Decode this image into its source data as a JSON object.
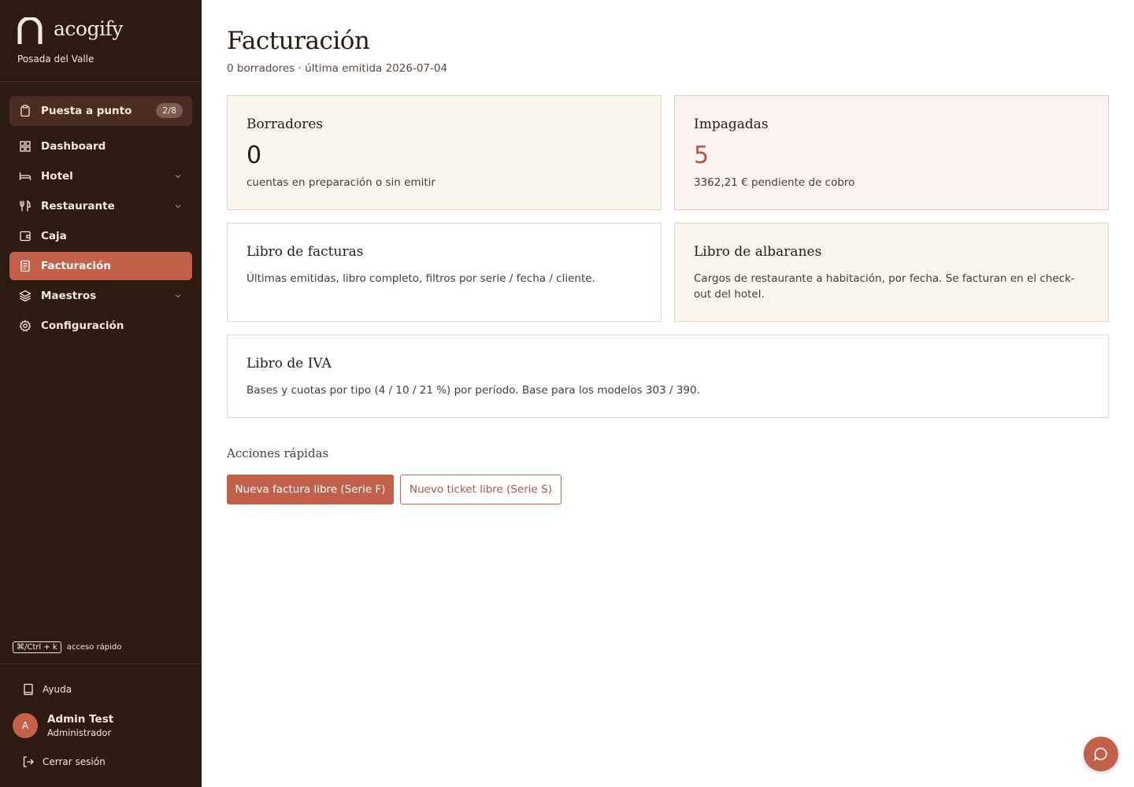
{
  "brand": {
    "name": "acogify",
    "property": "Posada del Valle"
  },
  "nav": {
    "setup": {
      "label": "Puesta a punto",
      "badge": "2/8"
    },
    "items": [
      {
        "label": "Dashboard",
        "icon": "grid-icon"
      },
      {
        "label": "Hotel",
        "icon": "bed-icon",
        "expandable": true
      },
      {
        "label": "Restaurante",
        "icon": "utensils-icon",
        "expandable": true
      },
      {
        "label": "Caja",
        "icon": "wallet-icon"
      },
      {
        "label": "Facturación",
        "icon": "document-icon",
        "active": true
      },
      {
        "label": "Maestros",
        "icon": "layers-icon",
        "expandable": true
      },
      {
        "label": "Configuración",
        "icon": "gear-icon"
      }
    ]
  },
  "shortcut": {
    "key": "⌘/Ctrl + k",
    "label": "acceso rápido"
  },
  "footer": {
    "help": "Ayuda",
    "user": {
      "initial": "A",
      "name": "Admin Test",
      "role": "Administrador"
    },
    "logout": "Cerrar sesión"
  },
  "page": {
    "title": "Facturación",
    "subtitle": "0 borradores · última emitida 2026-07-04"
  },
  "cards": {
    "drafts": {
      "title": "Borradores",
      "value": "0",
      "desc": "cuentas en preparación o sin emitir"
    },
    "unpaid": {
      "title": "Impagadas",
      "value": "5",
      "desc": "3362,21 € pendiente de cobro"
    },
    "invoice_book": {
      "title": "Libro de facturas",
      "desc": "Últimas emitidas, libro completo, filtros por serie / fecha / cliente."
    },
    "delivery_book": {
      "title": "Libro de albaranes",
      "desc": "Cargos de restaurante a habitación, por fecha. Se facturan en el check-out del hotel."
    },
    "vat_book": {
      "title": "Libro de IVA",
      "desc": "Bases y cuotas por tipo (4 / 10 / 21 %) por período. Base para los modelos 303 / 390."
    }
  },
  "quick_actions": {
    "title": "Acciones rápidas",
    "new_invoice": "Nueva factura libre (Serie F)",
    "new_ticket": "Nuevo ticket libre (Serie S)"
  },
  "colors": {
    "sidebar_bg": "#2d1a13",
    "accent": "#c2604a",
    "unpaid_value": "#b5553f"
  }
}
